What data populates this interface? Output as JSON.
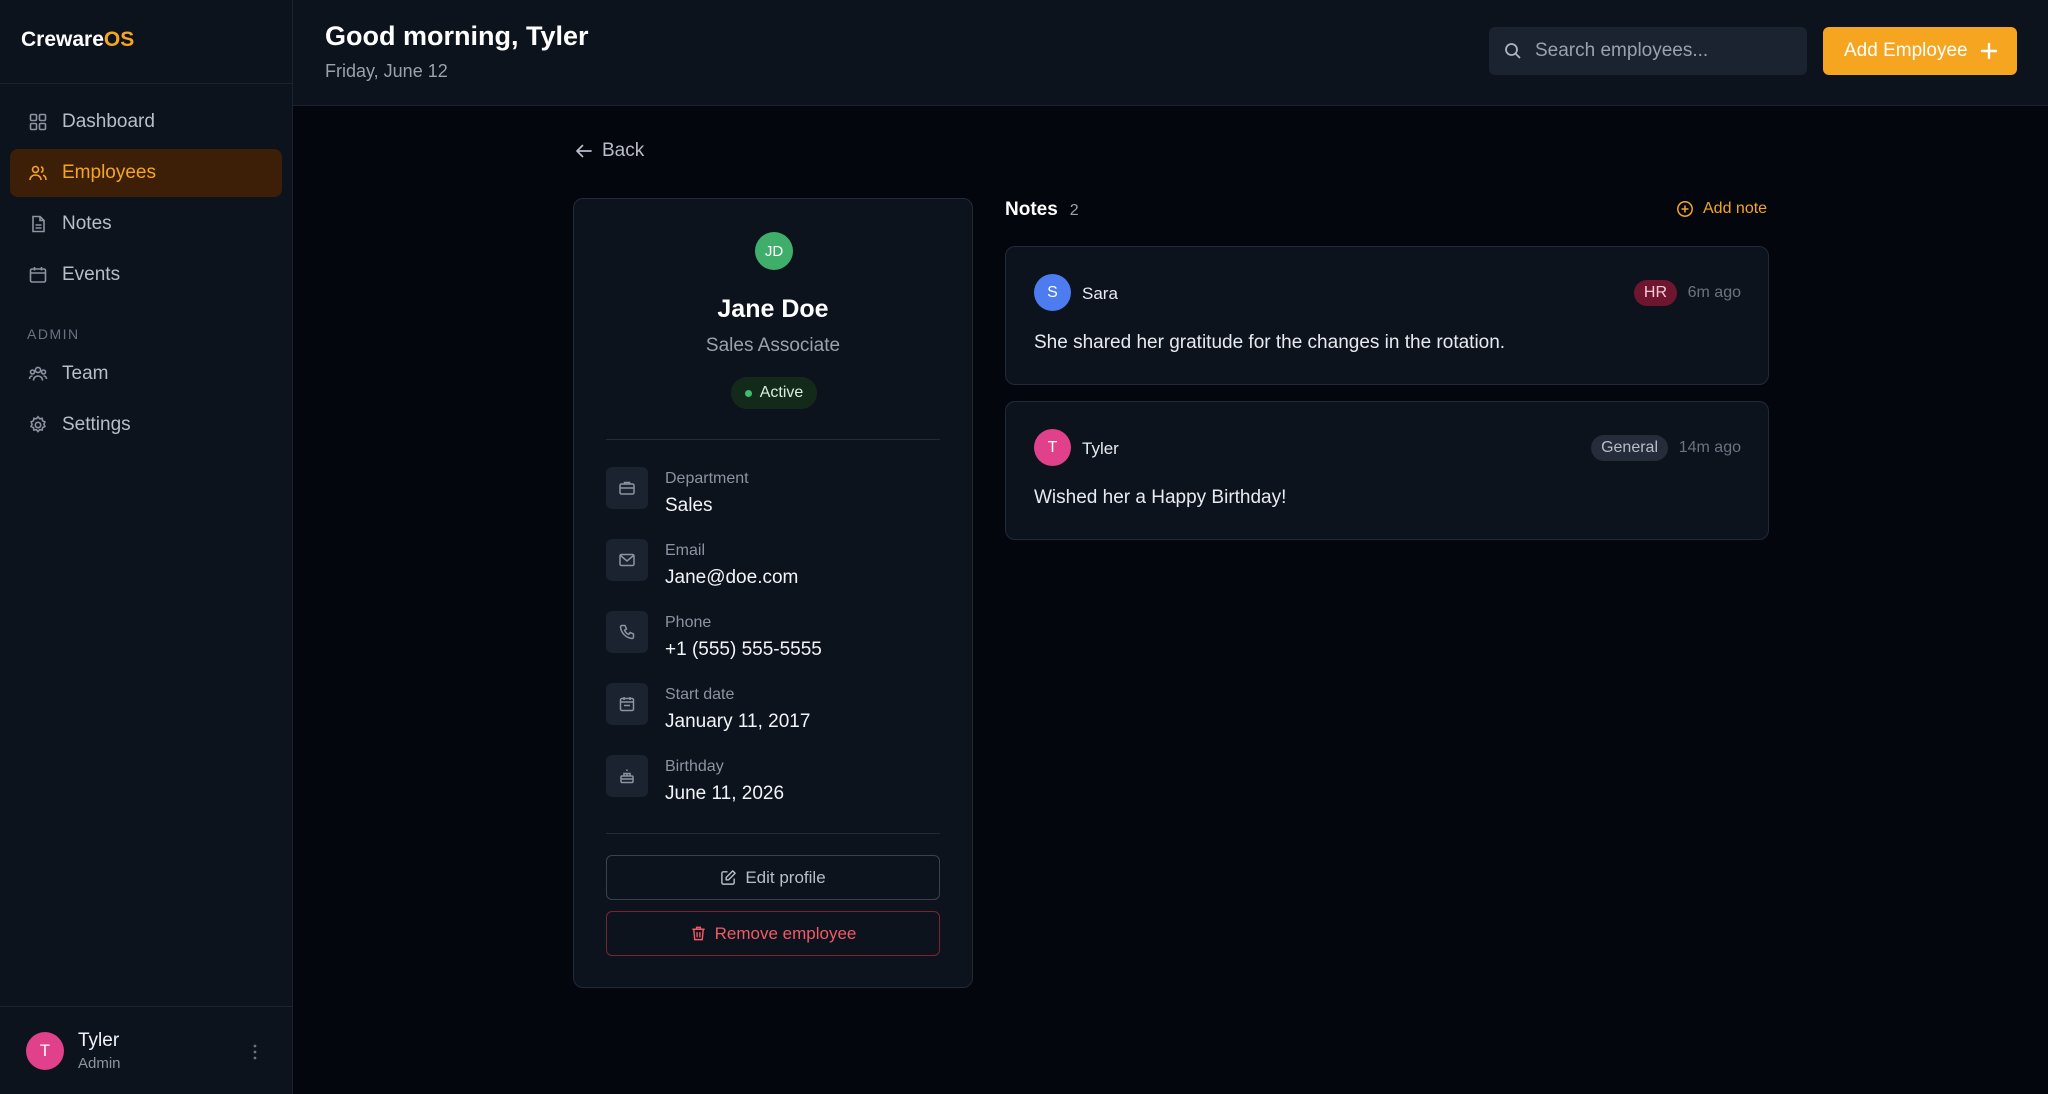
{
  "brand": {
    "name": "Creware",
    "accent": "OS"
  },
  "sidebar": {
    "items": [
      {
        "label": "Dashboard"
      },
      {
        "label": "Employees"
      },
      {
        "label": "Notes"
      },
      {
        "label": "Events"
      }
    ],
    "admin_section": "ADMIN",
    "admin_items": [
      {
        "label": "Team"
      },
      {
        "label": "Settings"
      }
    ],
    "user": {
      "initial": "T",
      "name": "Tyler",
      "role": "Admin"
    }
  },
  "header": {
    "greeting": "Good morning, Tyler",
    "date": "Friday, June 12",
    "search_placeholder": "Search employees...",
    "add_button": "Add Employee"
  },
  "back_label": "Back",
  "profile": {
    "initials": "JD",
    "name": "Jane Doe",
    "title": "Sales Associate",
    "status": "Active",
    "fields": [
      {
        "label": "Department",
        "value": "Sales"
      },
      {
        "label": "Email",
        "value": "Jane@doe.com"
      },
      {
        "label": "Phone",
        "value": "+1 (555) 555-5555"
      },
      {
        "label": "Start date",
        "value": "January 11, 2017"
      },
      {
        "label": "Birthday",
        "value": "June 11, 2026"
      }
    ],
    "edit_label": "Edit profile",
    "remove_label": "Remove employee"
  },
  "notes": {
    "title": "Notes",
    "count": "2",
    "add_label": "Add note",
    "items": [
      {
        "initial": "S",
        "author": "Sara",
        "tag": "HR",
        "time": "6m ago",
        "body": "She shared her gratitude for the changes in the rotation."
      },
      {
        "initial": "T",
        "author": "Tyler",
        "tag": "General",
        "time": "14m ago",
        "body": "Wished her a Happy Birthday!"
      }
    ]
  },
  "colors": {
    "accent": "#f6a521",
    "background": "#04060d",
    "panel": "#0d131d",
    "success": "#3fbf6b",
    "danger": "#ef5a66"
  }
}
